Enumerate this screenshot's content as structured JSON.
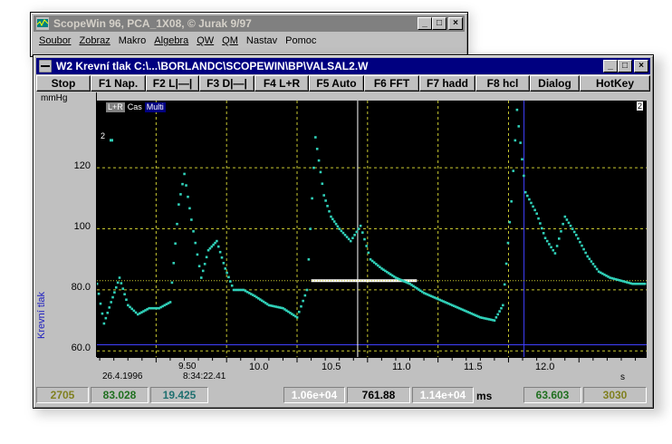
{
  "back_window": {
    "title": "ScopeWin 96, PCA_1X08,  © Jurak 9/97",
    "menu": [
      {
        "label": "Soubor"
      },
      {
        "label": "Zobraz"
      },
      {
        "label": "Makro"
      },
      {
        "label": "Algebra"
      },
      {
        "label": "QW"
      },
      {
        "label": "QM"
      },
      {
        "label": "Nastav"
      },
      {
        "label": "Pomoc"
      }
    ]
  },
  "scope_window": {
    "title": "W2 Krevní tlak C:\\...\\BORLANDC\\SCOPEWIN\\BP\\VALSAL2.W",
    "toolbar": [
      {
        "label": "Stop"
      },
      {
        "label": "F1 Nap."
      },
      {
        "label": "F2 L|—|"
      },
      {
        "label": "F3 D|—|"
      },
      {
        "label": "F4 L+R"
      },
      {
        "label": "F5 Auto"
      },
      {
        "label": "F6 FFT"
      },
      {
        "label": "F7 hadd"
      },
      {
        "label": "F8 hcl"
      },
      {
        "label": "Dialog"
      },
      {
        "label": "HotKey"
      }
    ],
    "plot": {
      "y_unit": "mmHg",
      "y_axis_title": "Krevní tlak",
      "y_ticks": [
        "120",
        "100",
        "80.0",
        "60.0"
      ],
      "x_ticks": [
        "9.50",
        "10.0",
        "10.5",
        "11.0",
        "11.5",
        "12.0"
      ],
      "x_unit": "s",
      "date": "26.4.1996",
      "time": "8:34:22.41",
      "legend": {
        "lr": "L+R",
        "cas": "Cas",
        "multi": "Multi"
      },
      "channel_marker": "2",
      "channel_number": "2"
    },
    "status": {
      "left1": "2705",
      "left2": "83.028",
      "left3": "19.425",
      "mid1": "1.06e+04",
      "mid2": "761.88",
      "mid3": "1.14e+04",
      "mid_unit": "ms",
      "right1": "63.603",
      "right2": "3030"
    },
    "colors": {
      "trace": "#30d0b8",
      "grid": "#c8c830",
      "cursor_h": "#ffffff",
      "cursor_v": "#ffffff",
      "blue_line": "#4040ff"
    }
  },
  "chart_data": {
    "type": "scatter",
    "xlabel": "s",
    "ylabel": "Krevní tlak",
    "ylim": [
      58,
      142
    ],
    "x_range": [
      9.08,
      12.98
    ],
    "series": [
      {
        "x": [
          9.08,
          9.13,
          9.18,
          9.24,
          9.3,
          9.37,
          9.45,
          9.52,
          9.6,
          9.66,
          9.7,
          9.75,
          9.82,
          9.87,
          9.93,
          9.99,
          10.05,
          10.12,
          10.2,
          10.3,
          10.4,
          10.5,
          10.57,
          10.63,
          10.69,
          10.74,
          10.8,
          10.88,
          10.95,
          11.02,
          11.1,
          11.2,
          11.3,
          11.4,
          11.5,
          11.6,
          11.7,
          11.8,
          11.9,
          11.96,
          12.02,
          12.06,
          12.12,
          12.2,
          12.26,
          12.33,
          12.4,
          12.48,
          12.56,
          12.64,
          12.72,
          12.8,
          12.88,
          12.98
        ],
        "y": [
          82,
          69,
          76,
          84,
          75,
          72,
          74,
          74,
          76,
          108,
          118,
          103,
          84,
          93,
          96,
          87,
          80,
          80,
          78,
          75,
          74,
          71,
          80,
          130,
          111,
          104,
          100,
          96,
          101,
          90,
          87,
          84,
          82,
          79,
          77,
          75,
          73,
          71,
          70,
          75,
          109,
          139,
          112,
          105,
          97,
          92,
          104,
          98,
          91,
          86,
          84,
          83,
          82,
          82
        ]
      }
    ]
  }
}
